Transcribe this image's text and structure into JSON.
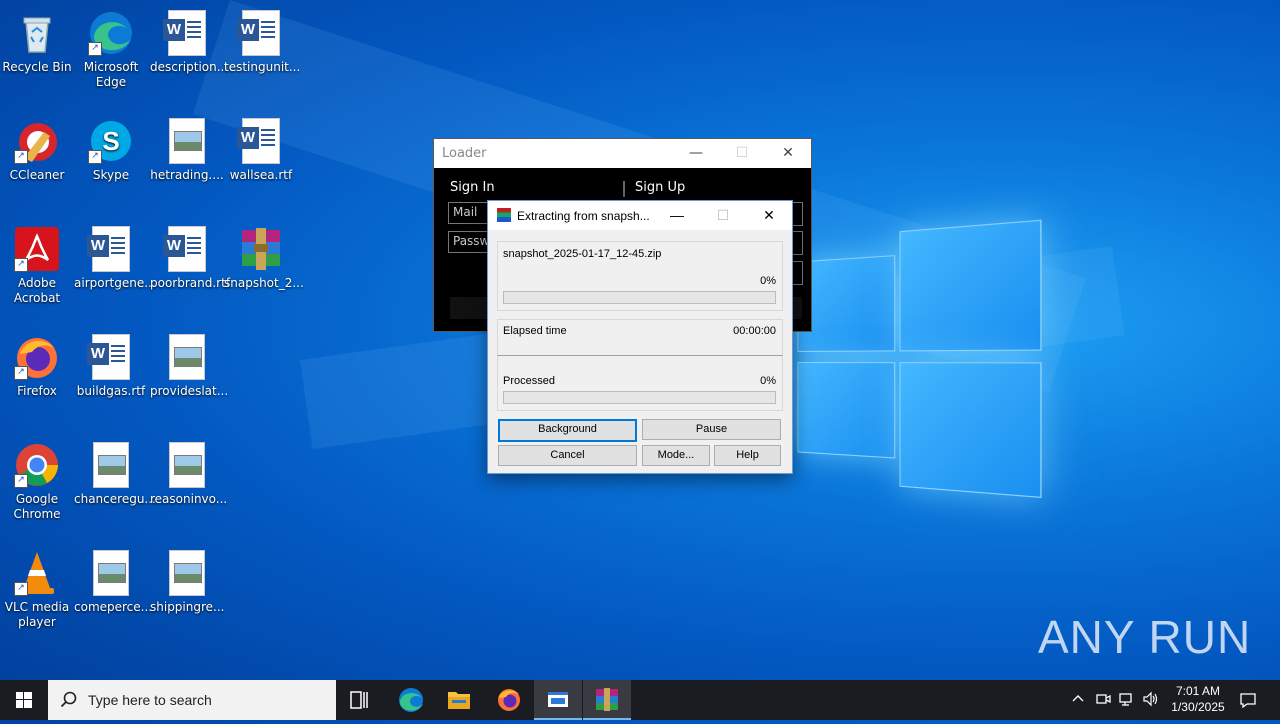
{
  "desktop": {
    "icons": [
      {
        "label": "Recycle Bin"
      },
      {
        "label": "Microsoft Edge"
      },
      {
        "label": "description..."
      },
      {
        "label": "testingunit..."
      },
      {
        "label": "CCleaner"
      },
      {
        "label": "Skype"
      },
      {
        "label": "hetrading...."
      },
      {
        "label": "wallsea.rtf"
      },
      {
        "label": "Adobe Acrobat"
      },
      {
        "label": "airportgene..."
      },
      {
        "label": "poorbrand.rtf"
      },
      {
        "label": "snapshot_2..."
      },
      {
        "label": "Firefox"
      },
      {
        "label": "buildgas.rtf"
      },
      {
        "label": "provideslat..."
      },
      {
        "label": "Google Chrome"
      },
      {
        "label": "chanceregu..."
      },
      {
        "label": "reasoninvo..."
      },
      {
        "label": "VLC media player"
      },
      {
        "label": "comeperce..."
      },
      {
        "label": "shippingre..."
      }
    ],
    "watermark": "ANY RUN"
  },
  "loader": {
    "title": "Loader",
    "sign_in": "Sign In",
    "sign_up": "Sign Up",
    "mail_placeholder": "Mail",
    "password_placeholder": "Passwo"
  },
  "winrar": {
    "title": "Extracting from snapsh...",
    "filename": "snapshot_2025-01-17_12-45.zip",
    "file_percent": "0%",
    "file_progress": 0,
    "elapsed_label": "Elapsed time",
    "elapsed_value": "00:00:00",
    "processed_label": "Processed",
    "processed_percent": "0%",
    "processed_progress": 0,
    "buttons": {
      "background": "Background",
      "pause": "Pause",
      "cancel": "Cancel",
      "mode": "Mode...",
      "help": "Help"
    }
  },
  "taskbar": {
    "search_placeholder": "Type here to search",
    "time": "7:01 AM",
    "date": "1/30/2025"
  }
}
